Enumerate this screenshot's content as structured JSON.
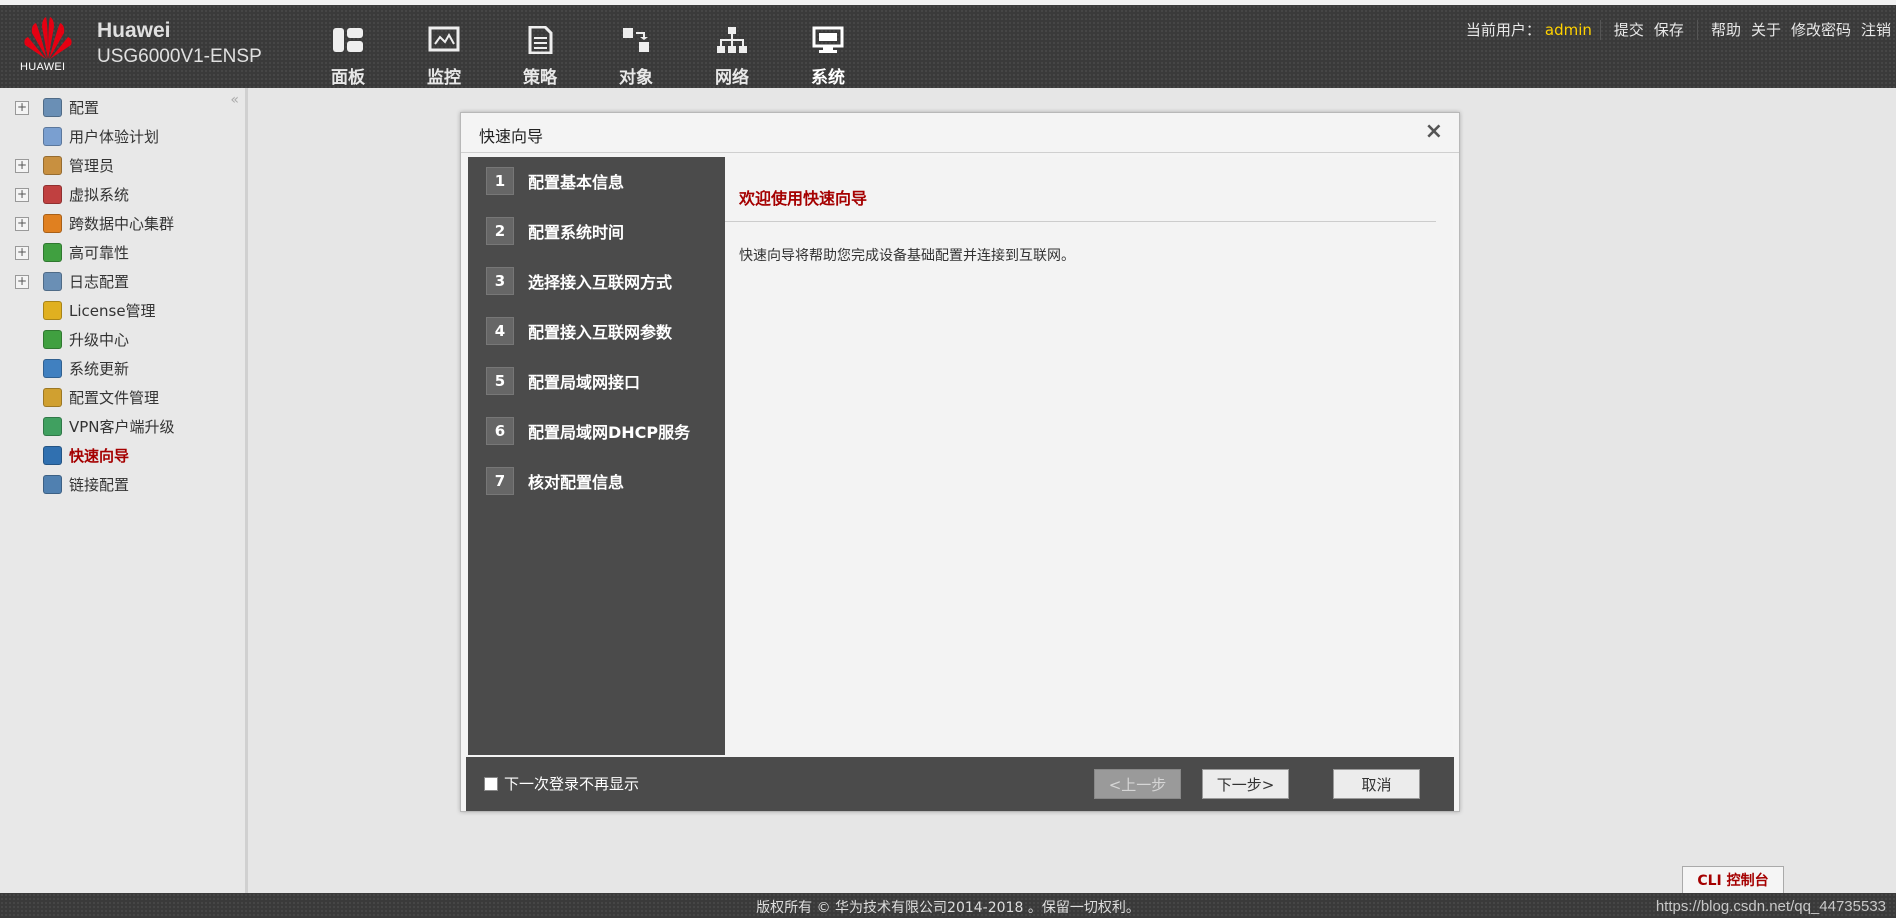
{
  "header": {
    "logo_text": "HUAWEI",
    "brand_name": "Huawei",
    "brand_model": "USG6000V1-ENSP",
    "nav": [
      {
        "label": "面板",
        "icon": "dashboard-icon"
      },
      {
        "label": "监控",
        "icon": "monitor-icon"
      },
      {
        "label": "策略",
        "icon": "policy-icon"
      },
      {
        "label": "对象",
        "icon": "object-icon"
      },
      {
        "label": "网络",
        "icon": "network-icon"
      },
      {
        "label": "系统",
        "icon": "system-icon"
      }
    ],
    "active_nav": "系统",
    "current_user_label": "当前用户：",
    "current_user": "admin",
    "links": {
      "submit": "提交",
      "save": "保存",
      "help": "帮助",
      "about": "关于",
      "change_password": "修改密码",
      "logout": "注销"
    }
  },
  "sidebar": {
    "collapse_glyph": "«",
    "items": [
      {
        "label": "配置",
        "expandable": true,
        "icon": "config-icon",
        "color": "#6a8fb5"
      },
      {
        "label": "用户体验计划",
        "expandable": false,
        "icon": "user-experience-icon",
        "color": "#7a9fd0"
      },
      {
        "label": "管理员",
        "expandable": true,
        "icon": "admin-icon",
        "color": "#c89040"
      },
      {
        "label": "虚拟系统",
        "expandable": true,
        "icon": "virtual-system-icon",
        "color": "#c04040"
      },
      {
        "label": "跨数据中心集群",
        "expandable": true,
        "icon": "cluster-icon",
        "color": "#e08020"
      },
      {
        "label": "高可靠性",
        "expandable": true,
        "icon": "high-availability-icon",
        "color": "#40a040"
      },
      {
        "label": "日志配置",
        "expandable": true,
        "icon": "log-config-icon",
        "color": "#6a8fb5"
      },
      {
        "label": "License管理",
        "expandable": false,
        "icon": "license-icon",
        "color": "#e0b020"
      },
      {
        "label": "升级中心",
        "expandable": false,
        "icon": "upgrade-center-icon",
        "color": "#40a040"
      },
      {
        "label": "系统更新",
        "expandable": false,
        "icon": "system-update-icon",
        "color": "#4080c0"
      },
      {
        "label": "配置文件管理",
        "expandable": false,
        "icon": "config-file-icon",
        "color": "#d0a030"
      },
      {
        "label": "VPN客户端升级",
        "expandable": false,
        "icon": "vpn-client-icon",
        "color": "#40a060"
      },
      {
        "label": "快速向导",
        "expandable": false,
        "icon": "quick-wizard-icon",
        "color": "#3070b0",
        "active": true
      },
      {
        "label": "链接配置",
        "expandable": false,
        "icon": "link-config-icon",
        "color": "#5080b0"
      }
    ]
  },
  "dialog": {
    "title": "快速向导",
    "close_glyph": "×",
    "steps": [
      {
        "num": "1",
        "label": "配置基本信息"
      },
      {
        "num": "2",
        "label": "配置系统时间"
      },
      {
        "num": "3",
        "label": "选择接入互联网方式"
      },
      {
        "num": "4",
        "label": "配置接入互联网参数"
      },
      {
        "num": "5",
        "label": "配置局域网接口"
      },
      {
        "num": "6",
        "label": "配置局域网DHCP服务"
      },
      {
        "num": "7",
        "label": "核对配置信息"
      }
    ],
    "content_title": "欢迎使用快速向导",
    "content_desc": "快速向导将帮助您完成设备基础配置并连接到互联网。",
    "no_show_label": "下一次登录不再显示",
    "no_show_checked": false,
    "prev_label": "<上一步",
    "prev_enabled": false,
    "next_label": "下一步>",
    "cancel_label": "取消"
  },
  "cli_console_label": "CLI 控制台",
  "footer": {
    "copyright": "版权所有 © 华为技术有限公司2014-2018 。保留一切权利。",
    "watermark": "https://blog.csdn.net/qq_44735533"
  },
  "colors": {
    "accent_red": "#a50000",
    "user_yellow": "#ffd200",
    "dark_bg": "#3a3a3a",
    "panel_dark": "#4b4b4b"
  }
}
